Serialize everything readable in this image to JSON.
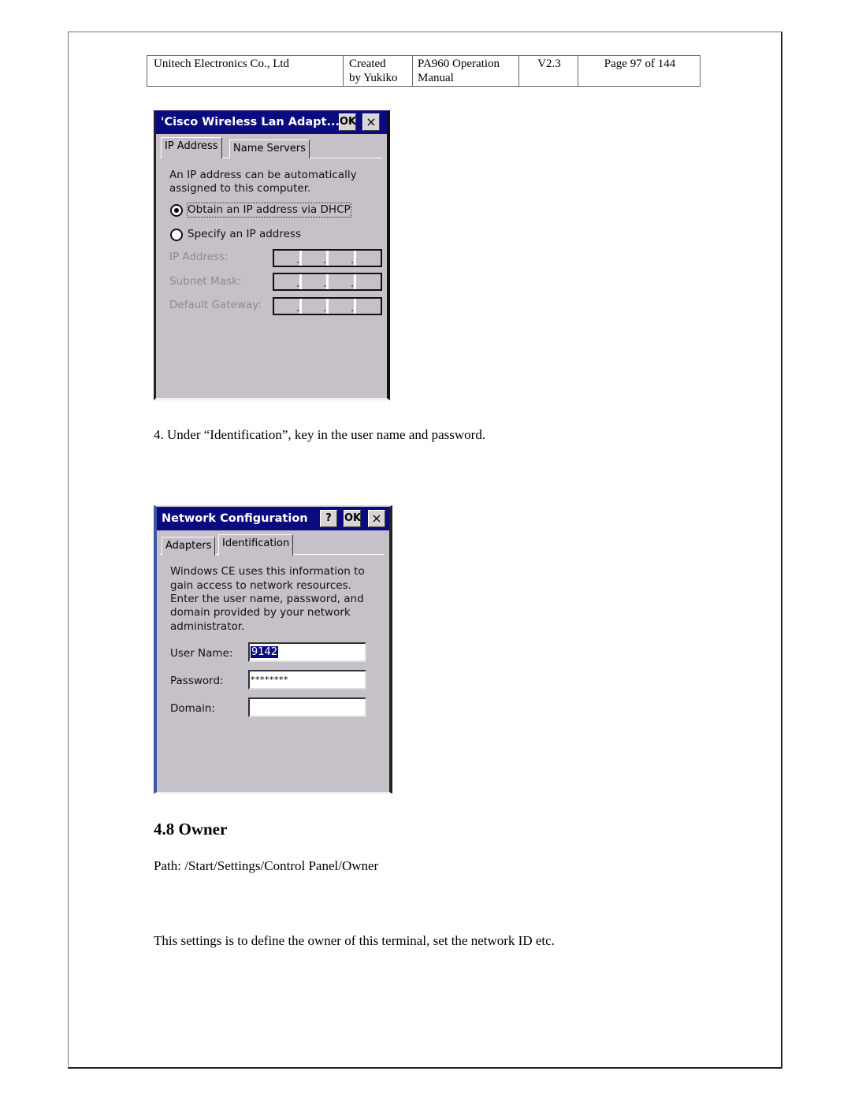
{
  "header": {
    "company": "Unitech Electronics Co., Ltd",
    "created_line1": "Created",
    "created_line2": "by Yukiko",
    "doc_line1": "PA960 Operation",
    "doc_line2": "Manual",
    "version": "V2.3",
    "page": "Page 97 of 144"
  },
  "dialog1": {
    "title": "'Cisco Wireless Lan Adapt...",
    "ok_label": "OK",
    "close_label": "×",
    "tabs": [
      {
        "label": "IP Address",
        "active": true
      },
      {
        "label": "Name Servers",
        "active": false
      }
    ],
    "intro_line1": "An IP address can be automatically",
    "intro_line2": "assigned to this computer.",
    "radio_dhcp": {
      "label": "Obtain an IP address via DHCP",
      "checked": true
    },
    "radio_specify": {
      "label": "Specify an IP address",
      "checked": false
    },
    "fields": [
      {
        "label": "IP Address:",
        "value": "",
        "enabled": false
      },
      {
        "label": "Subnet Mask:",
        "value": "",
        "enabled": false
      },
      {
        "label": "Default Gateway:",
        "value": "",
        "enabled": false
      }
    ]
  },
  "step4": "4. Under “Identification”, key in the user name and password.",
  "dialog2": {
    "title": "Network Configuration",
    "help_label": "?",
    "ok_label": "OK",
    "close_label": "×",
    "tabs": [
      {
        "label": "Adapters",
        "active": false
      },
      {
        "label": "Identification",
        "active": true
      }
    ],
    "intro_lines": [
      "Windows CE uses this information to",
      "gain access to network resources.",
      "Enter the user name, password, and",
      "domain provided by your network",
      "administrator."
    ],
    "user_name": {
      "label": "User Name:",
      "value": "9142"
    },
    "password": {
      "label": "Password:",
      "value": "********"
    },
    "domain": {
      "label": "Domain:",
      "value": ""
    }
  },
  "section": {
    "heading": "4.8 Owner",
    "path": "Path: /Start/Settings/Control Panel/Owner",
    "description": "This settings is to define the owner of this terminal, set the network ID etc."
  }
}
